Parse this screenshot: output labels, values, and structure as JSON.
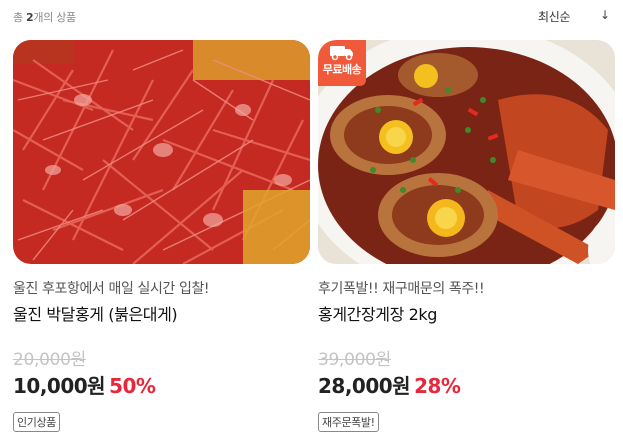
{
  "header": {
    "count_prefix": "총",
    "count_value": "2",
    "count_suffix": "개의 상품",
    "sort_label": "최신순",
    "sort_icon": "↓"
  },
  "products": [
    {
      "subtitle": "울진 후포항에서 매일 실시간 입찰!",
      "name": "울진 박달홍게 (붉은대게)",
      "original_price": "20,000원",
      "price": "10,000원",
      "discount": "50%",
      "tag": "인기상품",
      "image": "red-snow-crabs-pile"
    },
    {
      "subtitle": "후기폭발!! 재구매문의 폭주!!",
      "name": "홍게간장게장 2kg",
      "original_price": "39,000원",
      "price": "28,000원",
      "discount": "28%",
      "tag": "재주문폭발!",
      "badge": "무료배송",
      "badge_icon": "truck-icon",
      "image": "soy-marinated-crab-dish"
    }
  ],
  "colors": {
    "discount": "#e8263c",
    "badge_bg": "#f05a3a",
    "strike": "#c4c4c4"
  }
}
